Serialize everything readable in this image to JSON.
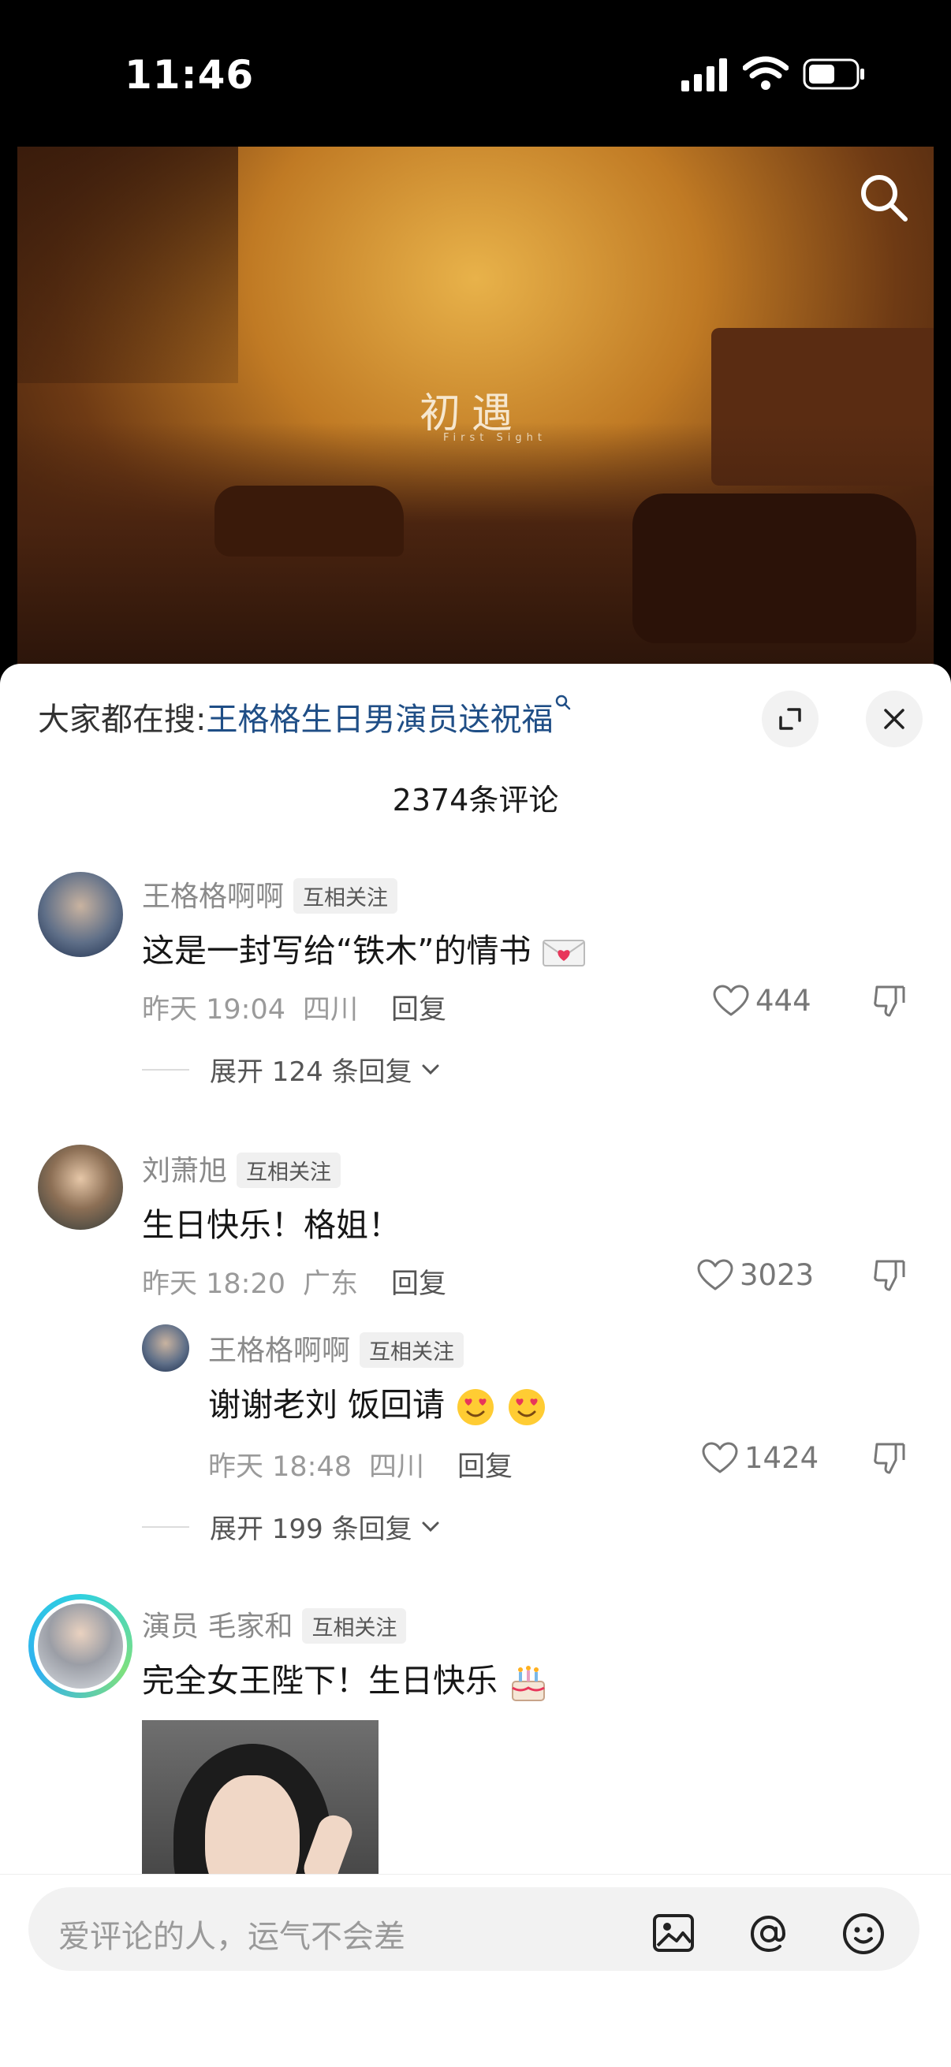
{
  "status_bar": {
    "time": "11:46"
  },
  "video": {
    "title": "初遇",
    "subtitle": "First Sight"
  },
  "sheet": {
    "hot_search_label": "大家都在搜:",
    "hot_search_term": "王格格生日男演员送祝福",
    "comment_count": "2374条评论"
  },
  "comments": [
    {
      "name": "王格格啊啊",
      "badge": "互相关注",
      "text": "这是一封写给“铁木”的情书",
      "time": "昨天 19:04",
      "location": "四川",
      "reply": "回复",
      "likes": "444",
      "expand": "展开 124 条回复"
    },
    {
      "name": "刘萧旭",
      "badge": "互相关注",
      "text": "生日快乐！格姐！",
      "time": "昨天 18:20",
      "location": "广东",
      "reply": "回复",
      "likes": "3023",
      "sub_reply": {
        "name": "王格格啊啊",
        "badge": "互相关注",
        "text": "谢谢老刘  饭回请",
        "time": "昨天 18:48",
        "location": "四川",
        "reply": "回复",
        "likes": "1424"
      },
      "expand": "展开 199 条回复"
    },
    {
      "name": "演员 毛家和",
      "badge": "互相关注",
      "text": "完全女王陛下！生日快乐"
    }
  ],
  "input": {
    "placeholder": "爱评论的人，运气不会差"
  },
  "colors": {
    "accent_link": "#1f4e86",
    "background": "#ffffff"
  }
}
